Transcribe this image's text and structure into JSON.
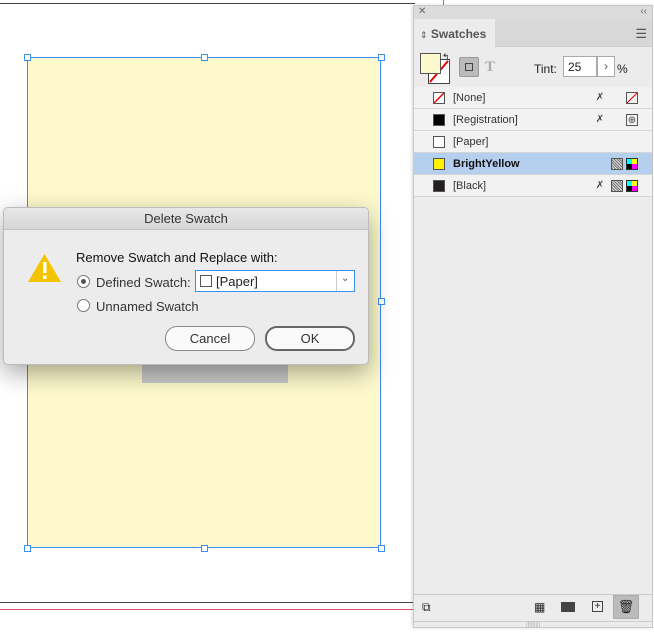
{
  "dialog": {
    "title": "Delete Swatch",
    "prompt": "Remove Swatch and Replace with:",
    "defined_label": "Defined Swatch:",
    "defined_value": "[Paper]",
    "unnamed_label": "Unnamed Swatch",
    "cancel": "Cancel",
    "ok": "OK"
  },
  "panel": {
    "tab": "Swatches",
    "tint_label": "Tint:",
    "tint_value": "25",
    "tint_unit": "%",
    "text_icon": "T",
    "swatches": [
      {
        "name": "[None]",
        "color": "none"
      },
      {
        "name": "[Registration]",
        "color": "#000000"
      },
      {
        "name": "[Paper]",
        "color": "#ffffff"
      },
      {
        "name": "BrightYellow",
        "color": "#fff200"
      },
      {
        "name": "[Black]",
        "color": "#231f20"
      }
    ]
  },
  "colors": {
    "frame_fill": "#fdf9cc",
    "selection": "#3a8ff0",
    "accent": "#b5d0ef"
  }
}
